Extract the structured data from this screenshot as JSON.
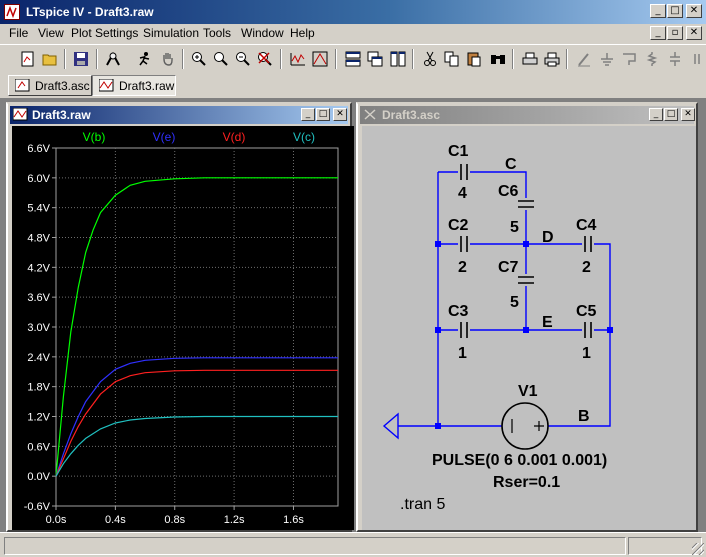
{
  "window": {
    "title": "LTspice IV - Draft3.raw"
  },
  "menu": [
    "File",
    "View",
    "Plot Settings",
    "Simulation",
    "Tools",
    "Window",
    "Help"
  ],
  "toolbar_icons": [
    "new-schematic-icon",
    "open-icon",
    "save-icon",
    "control-panel-icon",
    "run-icon",
    "halt-icon",
    "zoom-in-icon",
    "zoom-pan-icon",
    "zoom-out-icon",
    "zoom-cancel-icon",
    "autorange-icon",
    "mark-icon",
    "tile-horizontal-icon",
    "cascade-icon",
    "tile-vertical-icon",
    "cut-icon",
    "copy-icon",
    "paste-icon",
    "find-icon",
    "print-preview-icon",
    "print-icon",
    "wire-icon",
    "ground-icon",
    "label-icon",
    "resistor-icon",
    "capacitor-icon"
  ],
  "tabs": [
    "Draft3.asc",
    "Draft3.raw"
  ],
  "plot_window": {
    "title": "Draft3.raw"
  },
  "schematic_window": {
    "title": "Draft3.asc"
  },
  "colors": {
    "vb": "#00ff00",
    "ve": "#3030ff",
    "vd": "#ff2020",
    "vc": "#20c0c0",
    "wire": "#0000ff",
    "background": "#000000"
  },
  "chart_data": {
    "type": "line",
    "title": "",
    "xlabel": "",
    "ylabel": "",
    "xlim": [
      0,
      1.9
    ],
    "ylim": [
      -0.6,
      6.6
    ],
    "y_ticks": [
      "6.6V",
      "6.0V",
      "5.4V",
      "4.8V",
      "4.2V",
      "3.6V",
      "3.0V",
      "2.4V",
      "1.8V",
      "1.2V",
      "0.6V",
      "0.0V",
      "-0.6V"
    ],
    "x_ticks": [
      "0.0s",
      "0.4s",
      "0.8s",
      "1.2s",
      "1.6s"
    ],
    "grid": true,
    "legend_position": "top",
    "series": [
      {
        "name": "V(b)",
        "x": [
          0,
          0.05,
          0.1,
          0.15,
          0.2,
          0.25,
          0.3,
          0.4,
          0.5,
          0.6,
          0.8,
          1.0,
          1.2,
          1.5,
          1.9
        ],
        "y": [
          0,
          1.6,
          2.9,
          3.8,
          4.5,
          4.95,
          5.3,
          5.65,
          5.85,
          5.93,
          5.98,
          6.0,
          6.0,
          6.0,
          6.0
        ]
      },
      {
        "name": "V(e)",
        "x": [
          0,
          0.05,
          0.1,
          0.15,
          0.2,
          0.3,
          0.4,
          0.5,
          0.6,
          0.8,
          1.0,
          1.2,
          1.5,
          1.9
        ],
        "y": [
          0,
          0.45,
          0.85,
          1.2,
          1.5,
          1.9,
          2.15,
          2.27,
          2.33,
          2.37,
          2.38,
          2.38,
          2.38,
          2.38
        ]
      },
      {
        "name": "V(d)",
        "x": [
          0,
          0.05,
          0.1,
          0.15,
          0.2,
          0.3,
          0.4,
          0.5,
          0.6,
          0.8,
          1.0,
          1.2,
          1.5,
          1.9
        ],
        "y": [
          0,
          0.35,
          0.7,
          1.0,
          1.25,
          1.65,
          1.9,
          2.02,
          2.08,
          2.12,
          2.13,
          2.13,
          2.13,
          2.13
        ]
      },
      {
        "name": "V(c)",
        "x": [
          0,
          0.05,
          0.1,
          0.15,
          0.2,
          0.3,
          0.4,
          0.5,
          0.6,
          0.8,
          1.0,
          1.2,
          1.5,
          1.9
        ],
        "y": [
          0,
          0.25,
          0.45,
          0.62,
          0.76,
          0.95,
          1.07,
          1.13,
          1.16,
          1.19,
          1.2,
          1.2,
          1.2,
          1.2
        ]
      }
    ]
  },
  "schematic": {
    "components": [
      {
        "ref": "C1",
        "value": "4"
      },
      {
        "ref": "C6",
        "value": "5"
      },
      {
        "ref": "C2",
        "value": "2"
      },
      {
        "ref": "C4",
        "value": "2"
      },
      {
        "ref": "C7",
        "value": "5"
      },
      {
        "ref": "C3",
        "value": "1"
      },
      {
        "ref": "C5",
        "value": "1"
      },
      {
        "ref": "V1",
        "value": ""
      }
    ],
    "nodes": [
      "C",
      "D",
      "E",
      "B"
    ],
    "source_value": "PULSE(0 6 0.001 0.001)",
    "source_rser": "Rser=0.1",
    "directive": ".tran 5"
  }
}
